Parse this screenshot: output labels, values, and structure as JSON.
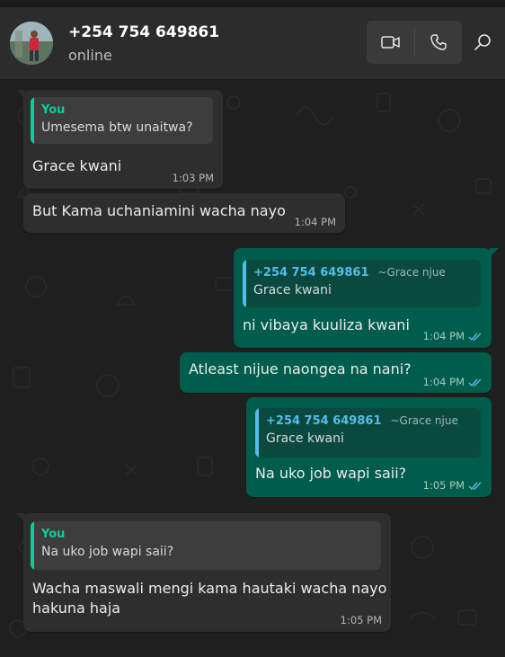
{
  "header": {
    "contact_name": "+254 754 649861",
    "status": "online",
    "icons": [
      "video-call-icon",
      "voice-call-icon",
      "search-icon"
    ]
  },
  "colors": {
    "incoming_bubble": "#2e2e2e",
    "outgoing_bubble": "#005c4b",
    "quote_you": "#06cf9c",
    "quote_contact": "#53bdeb",
    "read_ticks": "#53bdeb"
  },
  "messages": [
    {
      "direction": "incoming",
      "quote_author": "You",
      "quote_text": "Umesema btw unaitwa?",
      "text": "Grace kwani",
      "time": "1:03 PM"
    },
    {
      "direction": "incoming",
      "text": "But Kama uchaniamini wacha nayo",
      "time": "1:04 PM"
    },
    {
      "direction": "outgoing",
      "quote_author": "+254 754 649861",
      "quote_alias": "~Grace njue",
      "quote_text": "Grace kwani",
      "text": "ni vibaya kuuliza kwani",
      "time": "1:04 PM"
    },
    {
      "direction": "outgoing",
      "text": "Atleast nijue naongea na nani?",
      "time": "1:04 PM"
    },
    {
      "direction": "outgoing",
      "quote_author": "+254 754 649861",
      "quote_alias": "~Grace njue",
      "quote_text": "Grace kwani",
      "text": "Na uko job wapi saii?",
      "time": "1:05 PM"
    },
    {
      "direction": "incoming",
      "quote_author": "You",
      "quote_text": "Na uko job wapi saii?",
      "text_line1": "Wacha maswali mengi kama hautaki wacha nayo",
      "text_line2": "hakuna haja",
      "time": "1:05 PM"
    }
  ]
}
